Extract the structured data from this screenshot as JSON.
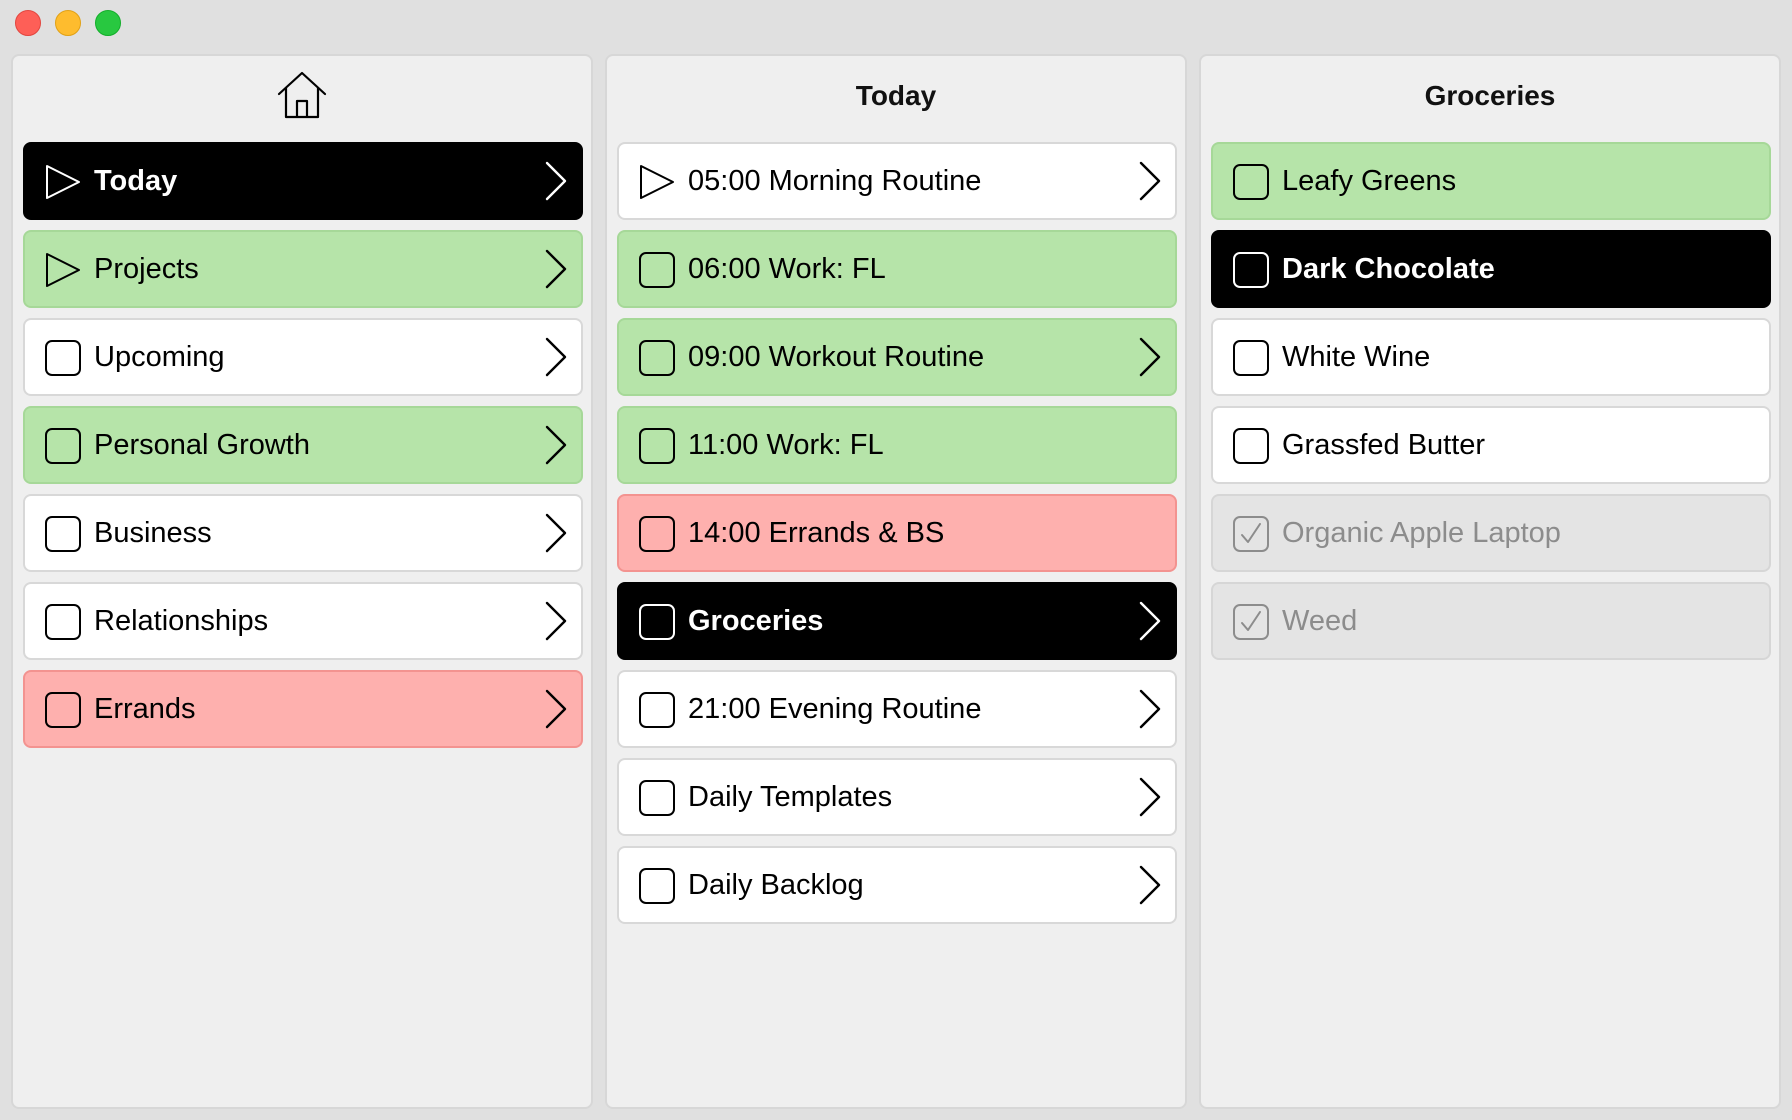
{
  "app": {
    "window_controls": [
      "close",
      "minimize",
      "zoom"
    ]
  },
  "colors": {
    "green": "#b6e4a9",
    "red": "#feb0ae",
    "selected": "#000000",
    "done": "#e4e4e4",
    "default": "#ffffff"
  },
  "columns": [
    {
      "title": "",
      "header_icon": "home-icon",
      "items": [
        {
          "label": "Today",
          "icon": "play-icon",
          "color": "black",
          "chevron": true
        },
        {
          "label": "Projects",
          "icon": "play-icon",
          "color": "green",
          "chevron": true
        },
        {
          "label": "Upcoming",
          "icon": "checkbox",
          "color": "white",
          "chevron": true
        },
        {
          "label": "Personal Growth",
          "icon": "checkbox",
          "color": "green",
          "chevron": true
        },
        {
          "label": "Business",
          "icon": "checkbox",
          "color": "white",
          "chevron": true
        },
        {
          "label": "Relationships",
          "icon": "checkbox",
          "color": "white",
          "chevron": true
        },
        {
          "label": "Errands",
          "icon": "checkbox",
          "color": "red",
          "chevron": true
        }
      ]
    },
    {
      "title": "Today",
      "header_icon": "",
      "items": [
        {
          "label": "05:00 Morning Routine",
          "icon": "play-icon",
          "color": "white",
          "chevron": true
        },
        {
          "label": "06:00 Work: FL",
          "icon": "checkbox",
          "color": "green",
          "chevron": false
        },
        {
          "label": "09:00 Workout Routine",
          "icon": "checkbox",
          "color": "green",
          "chevron": true
        },
        {
          "label": "11:00 Work: FL",
          "icon": "checkbox",
          "color": "green",
          "chevron": false
        },
        {
          "label": "14:00 Errands & BS",
          "icon": "checkbox",
          "color": "red",
          "chevron": false
        },
        {
          "label": "Groceries",
          "icon": "checkbox",
          "color": "black",
          "chevron": true
        },
        {
          "label": "21:00 Evening Routine",
          "icon": "checkbox",
          "color": "white",
          "chevron": true
        },
        {
          "label": "Daily Templates",
          "icon": "checkbox",
          "color": "white",
          "chevron": true
        },
        {
          "label": "Daily Backlog",
          "icon": "checkbox",
          "color": "white",
          "chevron": true
        }
      ]
    },
    {
      "title": "Groceries",
      "header_icon": "",
      "items": [
        {
          "label": "Leafy Greens",
          "icon": "checkbox",
          "color": "green",
          "chevron": false
        },
        {
          "label": "Dark Chocolate",
          "icon": "checkbox",
          "color": "black",
          "chevron": false
        },
        {
          "label": "White Wine",
          "icon": "checkbox",
          "color": "white",
          "chevron": false
        },
        {
          "label": "Grassfed Butter",
          "icon": "checkbox",
          "color": "white",
          "chevron": false
        },
        {
          "label": "Organic Apple Laptop",
          "icon": "checkbox-checked",
          "color": "done",
          "chevron": false
        },
        {
          "label": "Weed",
          "icon": "checkbox-checked",
          "color": "done",
          "chevron": false
        }
      ]
    }
  ]
}
